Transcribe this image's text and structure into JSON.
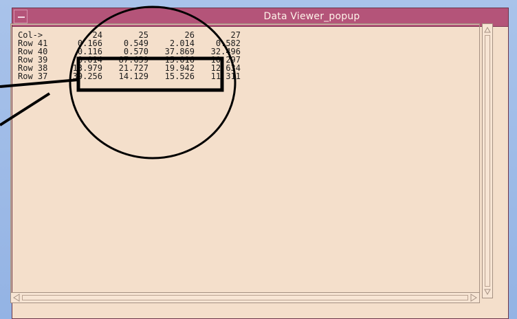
{
  "window": {
    "title": "Data Viewer_popup"
  },
  "table": {
    "header": {
      "label": "Col->",
      "cols": [
        "24",
        "25",
        "26",
        "27"
      ]
    },
    "rows": [
      {
        "label": "Row 41",
        "values": [
          "0.166",
          "0.549",
          "2.014",
          "0.582"
        ]
      },
      {
        "label": "Row 40",
        "values": [
          "0.116",
          "0.570",
          "37.869",
          "32.496"
        ]
      },
      {
        "label": "Row 39",
        "values": [
          "8.014",
          "87.659",
          "15.016",
          "10.297"
        ]
      },
      {
        "label": "Row 38",
        "values": [
          "13.979",
          "21.727",
          "19.942",
          "12.634"
        ]
      },
      {
        "label": "Row 37",
        "values": [
          "39.256",
          "14.129",
          "15.526",
          "11.311"
        ]
      }
    ]
  },
  "icons": {
    "menu": "window-menu-icon",
    "up": "arrow-up-icon",
    "down": "arrow-down-icon",
    "left": "arrow-left-icon",
    "right": "arrow-right-icon"
  }
}
